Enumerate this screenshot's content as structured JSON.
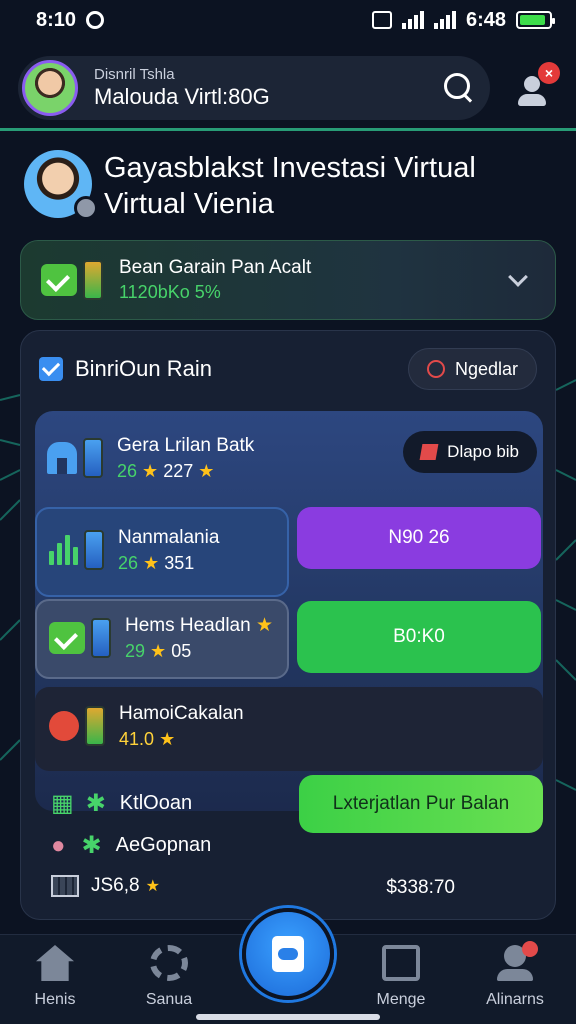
{
  "status_bar": {
    "time": "8:10",
    "clock": "6:48"
  },
  "header": {
    "search_small": "Disnril Tshla",
    "search_big": "Malouda Virtl:80G"
  },
  "profile": {
    "title": "Gayasblakst Investasi Virtual Virtual Vienia"
  },
  "earnings": {
    "label": "Bean Garain Pan Acalt",
    "value": "1120bKo 5%"
  },
  "panel": {
    "title": "BinriOun Rain",
    "button": "Ngedlar",
    "bank": {
      "name": "Gera Lrilan Batk",
      "value_a": "26",
      "value_b": "227",
      "pill": "Dlapo bib"
    },
    "items": [
      {
        "name": "Nanmalania",
        "value_a": "26",
        "value_b": "351",
        "action": "N90 26",
        "action_color": "#8a3ce0"
      },
      {
        "name": "Hems Headlan",
        "value_a": "29",
        "value_b": "05",
        "action": "B0:K0",
        "action_color": "#2bc24e"
      },
      {
        "name": "HamoiCakalan",
        "value": "41.0"
      }
    ],
    "list": [
      {
        "name": "KtlOoan"
      },
      {
        "name": "AeGopnan"
      }
    ],
    "list_button": "Lxterjatlan Pur Balan",
    "footer_left": "JS6,8",
    "footer_right": "$338:70"
  },
  "nav": {
    "items": [
      {
        "label": "Henis",
        "icon": "home-icon"
      },
      {
        "label": "Sanua",
        "icon": "gear-icon"
      },
      {
        "label": "Menge",
        "icon": "edit-icon"
      },
      {
        "label": "Alinarns",
        "icon": "user-icon"
      }
    ]
  },
  "colors": {
    "accent_green": "#47d36a",
    "accent_blue": "#2a80e8",
    "purple": "#8a3ce0"
  }
}
